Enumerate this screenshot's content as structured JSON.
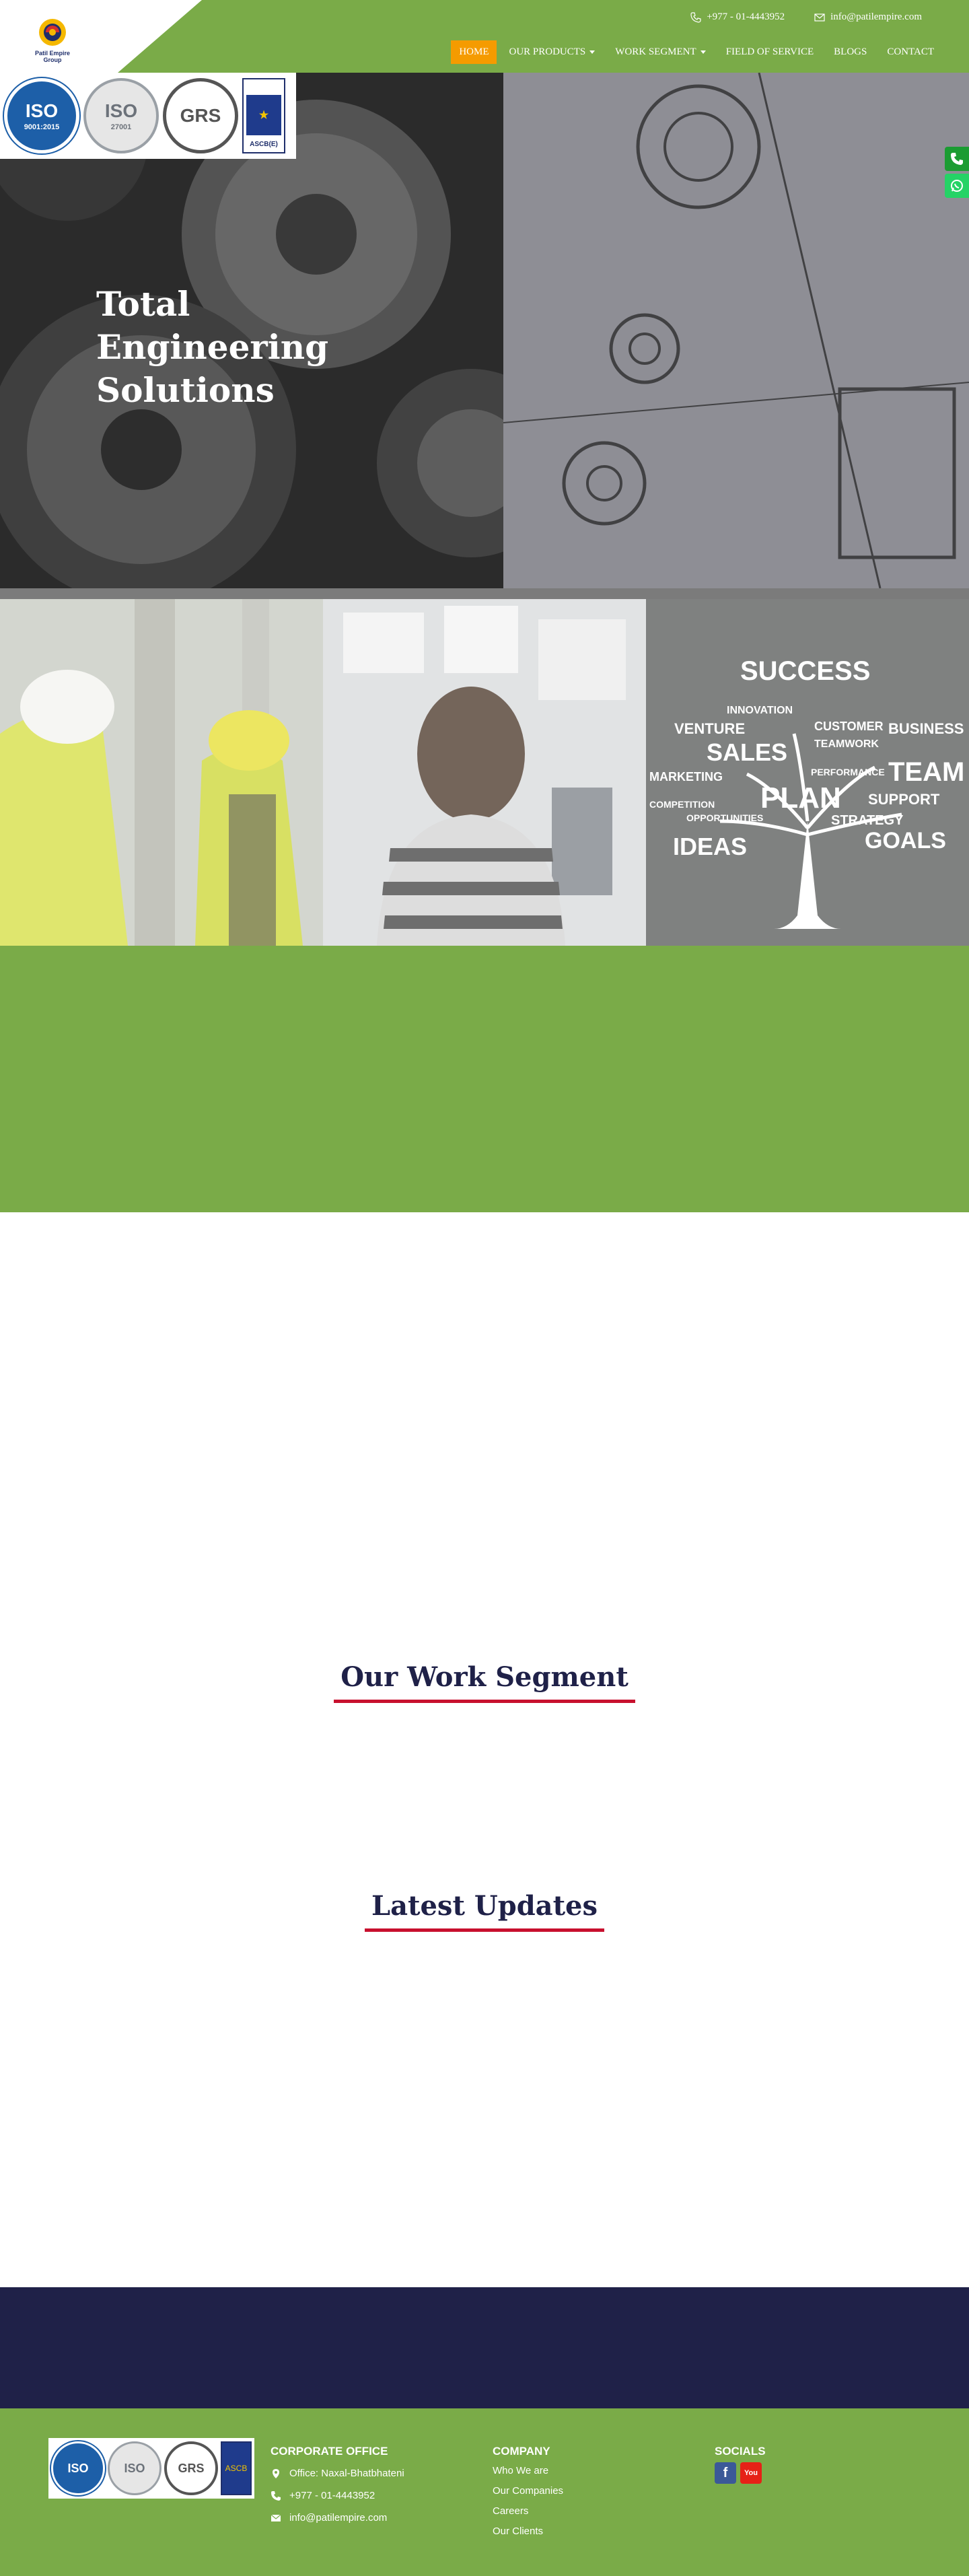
{
  "brand": {
    "logo_text": "Patil Empire Group"
  },
  "contact": {
    "phone": "+977 - 01-4443952",
    "email": "info@patilempire.com"
  },
  "nav": [
    {
      "label": "HOME",
      "active": true,
      "dropdown": false
    },
    {
      "label": "OUR PRODUCTS",
      "active": false,
      "dropdown": true
    },
    {
      "label": "WORK SEGMENT",
      "active": false,
      "dropdown": true
    },
    {
      "label": "FIELD OF SERVICE",
      "active": false,
      "dropdown": false
    },
    {
      "label": "BLOGS",
      "active": false,
      "dropdown": false
    },
    {
      "label": "CONTACT",
      "active": false,
      "dropdown": false
    }
  ],
  "certs": {
    "iso1": {
      "big": "ISO",
      "small": "9001:2015"
    },
    "iso2": {
      "big": "ISO",
      "small": "27001"
    },
    "grs": {
      "big": "GRS"
    },
    "ascb": {
      "label": "ASCB(E)"
    }
  },
  "hero": {
    "title": "Total Engineering Solutions"
  },
  "panels": [
    {
      "icon": "workers-image"
    },
    {
      "icon": "planner-image"
    },
    {
      "icon": "success-tree-image",
      "words": [
        "SUCCESS",
        "INNOVATION",
        "VENTURE",
        "CUSTOMER",
        "BUSINESS",
        "TEAMWORK",
        "SALES",
        "MARKETING",
        "PERFORMANCE",
        "TEAM",
        "PLAN",
        "COMPETITION",
        "OPPORTUNITIES",
        "SUPPORT",
        "STRATEGY",
        "IDEAS",
        "GOALS"
      ]
    }
  ],
  "sections": {
    "work": "Our Work Segment",
    "updates": "Latest Updates"
  },
  "footer": {
    "certs": {
      "iso1": "ISO",
      "iso2": "ISO",
      "grs": "GRS",
      "ascb": "ASCB"
    },
    "office": {
      "heading": "CORPORATE OFFICE",
      "address": "Office: Naxal-Bhatbhateni",
      "phone": "+977 - 01-4443952",
      "email": "info@patilempire.com"
    },
    "company": {
      "heading": "COMPANY",
      "links": [
        "Who We are",
        "Our Companies",
        "Careers",
        "Our Clients"
      ]
    },
    "socials": {
      "heading": "SOCIALS",
      "facebook": "f",
      "youtube": "You"
    }
  },
  "colors": {
    "green": "#7aab48",
    "navy": "#1f2148",
    "orange": "#f59b00",
    "red": "#c8102e"
  }
}
